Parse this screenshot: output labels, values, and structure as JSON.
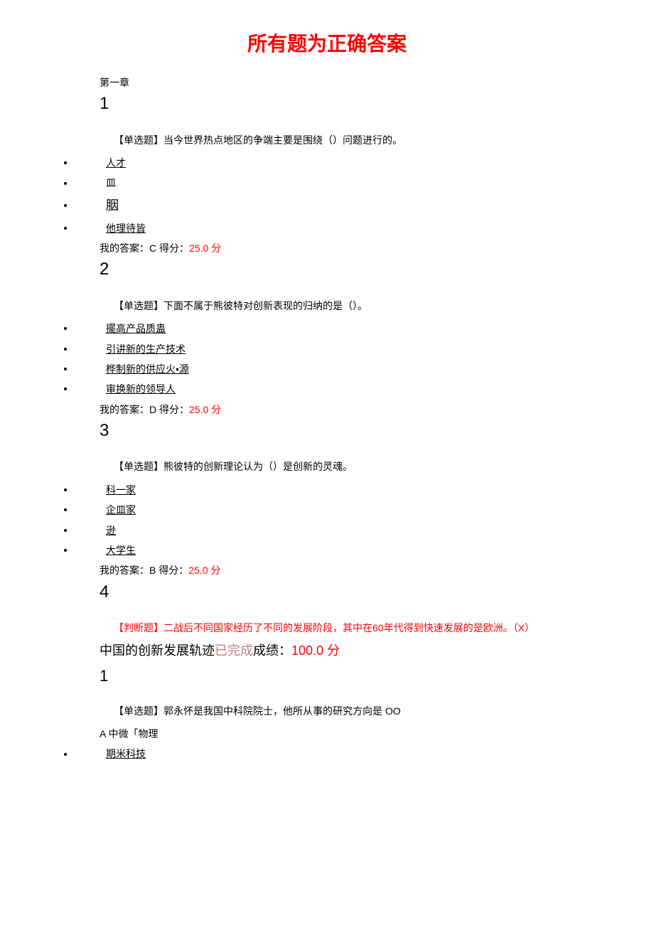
{
  "title": "所有题为正确答案",
  "chapter": "第一章",
  "q1": {
    "number": "1",
    "text": "【单选题】当今世界热点地区的争端主要是围绕（）问题进行的。",
    "options": [
      "人才",
      "皿",
      "胭",
      "他理待皆"
    ],
    "answer_prefix": "我的答案：C 得分：",
    "score": "25.0",
    "score_suffix": " 分"
  },
  "q2": {
    "number": "2",
    "text": "【单选题】下面不属于熊彼特对创新表现的归纳的是（）。",
    "options": [
      "擺高产品质蛊",
      "引讲新的生产技术",
      "桦制新的供应火•源",
      "审换新的领导人"
    ],
    "answer_prefix": "我的答案：D 得分：",
    "score": "25.0",
    "score_suffix": " 分"
  },
  "q3": {
    "number": "3",
    "text": "【单选题】熊彼特的创新理论认为（）是创新的灵魂。",
    "options": [
      "科一家",
      "企皿家",
      "逊",
      "大学生"
    ],
    "answer_prefix": "我的答案：B 得分：",
    "score": "25.0",
    "score_suffix": " 分"
  },
  "q4": {
    "number": "4",
    "judge_prefix": "【判断题】二战后不同国家经历了不同的发展阶段，其中在",
    "judge_highlight": "60",
    "judge_suffix": "年代得到快速发展的是欧洲。（X）"
  },
  "section2": {
    "title_prefix": "中国的创新发展轨迹",
    "status": "已完成",
    "grade_label": "成绩：",
    "grade": "100.0",
    "grade_suffix": " 分"
  },
  "s2q1": {
    "number": "1",
    "text_prefix": "【单选题】郭永怀是我国中科院院士，他所从事的研究方向是",
    "oo": "OO",
    "option_a": "A 中微「物理",
    "option_b": "期米科技"
  }
}
